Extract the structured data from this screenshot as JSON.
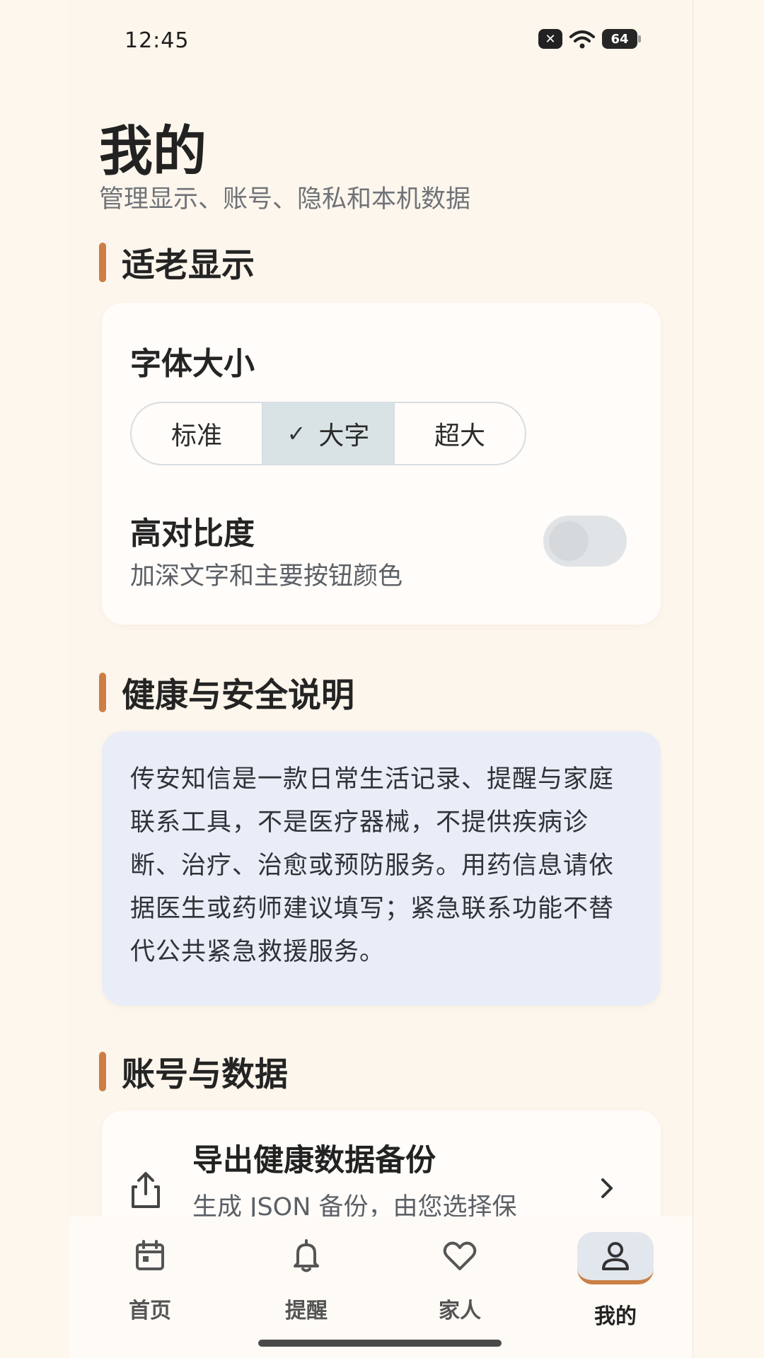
{
  "status_bar": {
    "time": "12:45",
    "battery": "64",
    "notice_icon": "close-box-icon",
    "wifi_icon": "wifi-icon"
  },
  "header": {
    "title": "我的",
    "subtitle": "管理显示、账号、隐私和本机数据"
  },
  "sections": {
    "display_title": "适老显示",
    "health_title": "健康与安全说明",
    "account_title": "账号与数据"
  },
  "display_card": {
    "font_size_label": "字体大小",
    "font_options": [
      "标准",
      "大字",
      "超大"
    ],
    "selected_font": "大字",
    "high_contrast_title": "高对比度",
    "high_contrast_desc": "加深文字和主要按钮颜色",
    "high_contrast_on": false
  },
  "health_notice": {
    "text": "传安知信是一款日常生活记录、提醒与家庭联系工具，不是医疗器械，不提供疾病诊断、治疗、治愈或预防服务。用药信息请依据医生或药师建议填写；紧急联系功能不替代公共紧急救援服务。"
  },
  "account_card": {
    "export_title": "导出健康数据备份",
    "export_desc": "生成 JSON 备份，由您选择保",
    "icon": "share-export-icon"
  },
  "bottom_nav": {
    "items": [
      {
        "label": "首页",
        "icon": "calendar-icon"
      },
      {
        "label": "提醒",
        "icon": "bell-icon"
      },
      {
        "label": "家人",
        "icon": "heart-icon"
      },
      {
        "label": "我的",
        "icon": "person-icon"
      }
    ],
    "active": "我的"
  },
  "colors": {
    "accent": "#cb7f46",
    "background": "#fdf6ec",
    "notice_bg": "#e9edf7",
    "segment_active": "#d9e3e5"
  }
}
